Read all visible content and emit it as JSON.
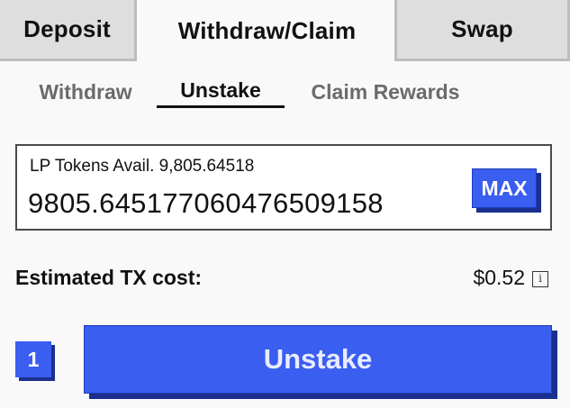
{
  "tabs": {
    "deposit": "Deposit",
    "withdraw_claim": "Withdraw/Claim",
    "swap": "Swap"
  },
  "sub_tabs": {
    "withdraw": "Withdraw",
    "unstake": "Unstake",
    "claim_rewards": "Claim Rewards"
  },
  "amount": {
    "avail_label": "LP Tokens Avail. 9,805.64518",
    "value": "9805.645177060476509158",
    "max_label": "MAX"
  },
  "tx": {
    "label": "Estimated TX cost:",
    "value": "$0.52",
    "info_glyph": "i"
  },
  "action": {
    "step": "1",
    "button_label": "Unstake"
  },
  "colors": {
    "accent": "#3a5ef0",
    "accent_shadow": "#1b2f8e",
    "tab_inactive": "#dedede"
  }
}
